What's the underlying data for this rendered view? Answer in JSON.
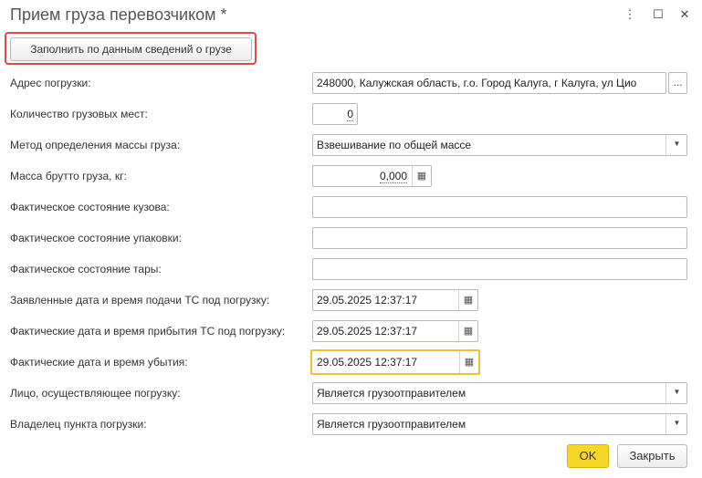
{
  "window": {
    "title": "Прием груза перевозчиком *",
    "menu_icon": "more-vertical-icon",
    "maximize_icon": "maximize-icon",
    "close_icon": "close-icon"
  },
  "toolbar": {
    "fill_button_label": "Заполнить по данным сведений о грузе"
  },
  "form": {
    "loading_address": {
      "label": "Адрес погрузки:",
      "value": "248000, Калужская область, г.о. Город Калуга, г Калуга, ул Цио",
      "button": "..."
    },
    "cargo_places": {
      "label": "Количество грузовых мест:",
      "value": "0"
    },
    "mass_method": {
      "label": "Метод определения массы груза:",
      "value": "Взвешивание по общей массе"
    },
    "gross_mass": {
      "label": "Масса брутто груза, кг:",
      "value": "0,000"
    },
    "body_state": {
      "label": "Фактическое состояние кузова:",
      "value": ""
    },
    "packaging_state": {
      "label": "Фактическое состояние упаковки:",
      "value": ""
    },
    "container_state": {
      "label": "Фактическое состояние тары:",
      "value": ""
    },
    "declared_datetime": {
      "label": "Заявленные дата и время подачи ТС под погрузку:",
      "value": "29.05.2025 12:37:17"
    },
    "arrival_datetime": {
      "label": "Фактические дата и время прибытия ТС под погрузку:",
      "value": "29.05.2025 12:37:17"
    },
    "departure_datetime": {
      "label": "Фактические дата и время убытия:",
      "value": "29.05.2025 12:37:17"
    },
    "loader": {
      "label": "Лицо, осуществляющее погрузку:",
      "value": "Является грузоотправителем"
    },
    "point_owner": {
      "label": "Владелец пункта погрузки:",
      "value": "Является грузоотправителем"
    }
  },
  "footer": {
    "ok_label": "OK",
    "close_label": "Закрыть"
  },
  "colors": {
    "highlight_frame": "#e04a4a",
    "ok_button": "#f7d727",
    "focus_border": "#f0c030"
  }
}
